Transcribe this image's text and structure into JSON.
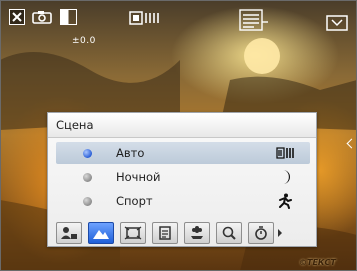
{
  "status_bar": {
    "icons": [
      "close-icon",
      "camera-icon",
      "white-balance-icon",
      "resolution-icon",
      "shot-count-icon",
      "quality-icon"
    ],
    "exposure_text": "±0.0"
  },
  "scene_menu": {
    "title": "Сцена",
    "items": [
      {
        "label": "Авто",
        "icon": "auto-scene-icon",
        "selected": true
      },
      {
        "label": "Ночной",
        "icon": "moon-icon",
        "selected": false
      },
      {
        "label": "Спорт",
        "icon": "sport-runner-icon",
        "selected": false
      }
    ]
  },
  "toolbar": {
    "buttons": [
      "scene-portrait-icon",
      "scene-landscape-icon",
      "scene-night-portrait-icon",
      "scene-document-icon",
      "scene-flower-icon",
      "zoom-icon",
      "timer-icon"
    ],
    "active_index": 1
  },
  "watermark": "©ТЕКСТ",
  "colors": {
    "accent": "#2b5fd6",
    "menu_bg": "#f2f2f2",
    "selected_row": "#c8d3e0"
  }
}
